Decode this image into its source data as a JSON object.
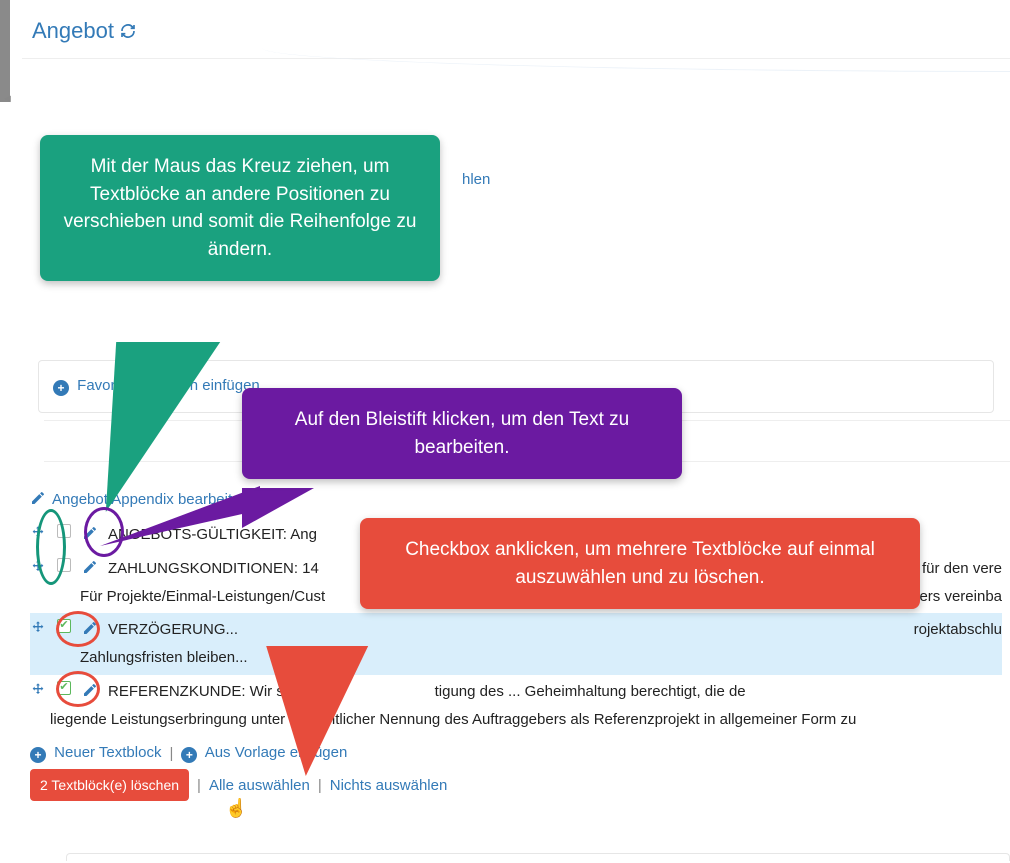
{
  "header": {
    "title": "Angebot"
  },
  "hidden_link_suffix": "hlen",
  "favoriten": {
    "label": "Favoriten-Position einfügen"
  },
  "appendix": {
    "edit_label": "Angebot Appendix bearbeiten"
  },
  "rows": [
    {
      "title": "ANGEBOTS-GÜLTIGKEIT: Ang",
      "selected": false,
      "cont": ""
    },
    {
      "title": "ZAHLUNGSKONDITIONEN: 14",
      "selected": false,
      "cont": "Für Projekte/Einmal-Leistungen/Cust",
      "tail": "für den vere",
      "tail2": "ers vereinba"
    },
    {
      "title": "VERZÖGERUNG...",
      "selected": true,
      "cont": "Zahlungsfristen bleiben...",
      "tail": "rojektabschlu"
    },
    {
      "title": "REFERENZKUNDE: Wir sind u",
      "selected": true,
      "mid": "tigung des ... Geheimhaltung berechtigt, die de",
      "cont": "liegende Leistungserbringung unter namentlicher Nennung des Auftraggebers als Referenzprojekt in allgemeiner Form zu"
    }
  ],
  "actions": {
    "new_block": "Neuer Textblock",
    "insert_template": "Aus Vorlage einfügen",
    "delete": "2 Textblöck(e) löschen",
    "select_all": "Alle auswählen",
    "select_none": "Nichts auswählen"
  },
  "callouts": {
    "green": "Mit der Maus das Kreuz ziehen, um Textblöcke an andere Positionen zu verschieben und somit die Reihenfolge zu ändern.",
    "purple": "Auf den Bleistift klicken, um den Text zu bearbeiten.",
    "red": "Checkbox anklicken, um mehrere Textblöcke auf einmal auszuwählen und zu löschen."
  }
}
